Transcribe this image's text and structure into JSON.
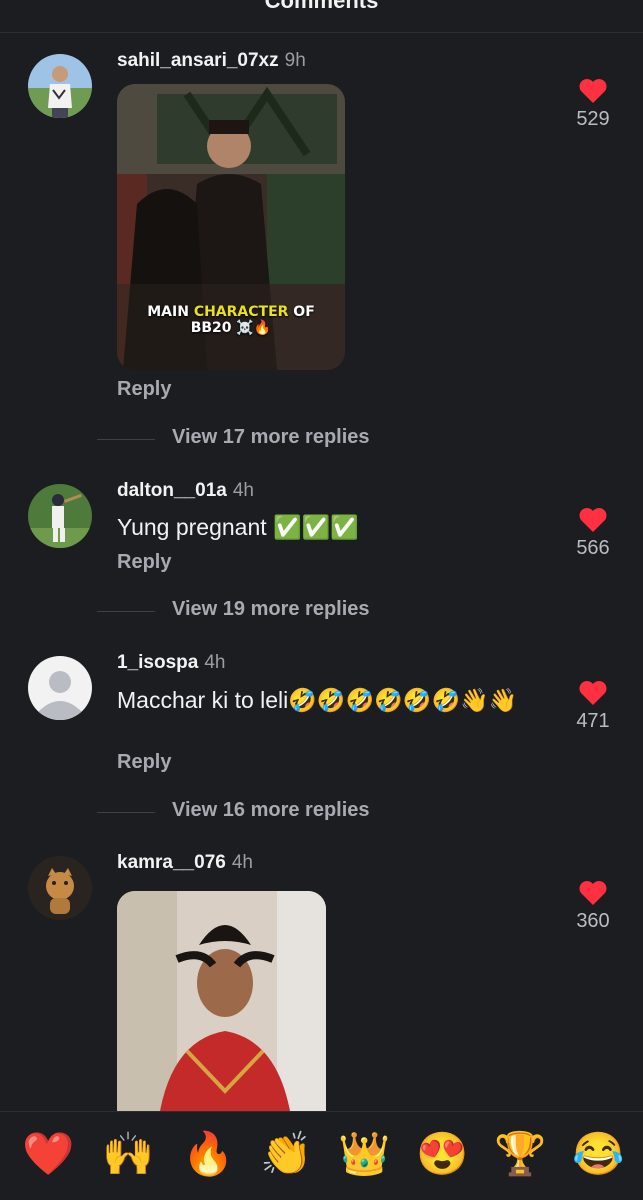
{
  "header": {
    "title": "Comments"
  },
  "comments": [
    {
      "username": "sahil_ansari_07xz",
      "time": "9h",
      "likes": "529",
      "reply_label": "Reply",
      "media_caption_1": "MAIN ",
      "media_caption_highlight": "CHARACTER",
      "media_caption_2": " OF",
      "media_caption_3": "BB20 ☠️🔥",
      "view_more": "View 17 more replies"
    },
    {
      "username": "dalton__01a",
      "time": "4h",
      "text": "Yung pregnant ✅✅✅",
      "likes": "566",
      "reply_label": "Reply",
      "view_more": "View 19 more replies"
    },
    {
      "username": "1_isospa",
      "time": "4h",
      "text": "Macchar ki to leli🤣🤣🤣🤣🤣🤣👋👋",
      "likes": "471",
      "reply_label": "Reply",
      "view_more": "View 16 more replies"
    },
    {
      "username": "kamra__076",
      "time": "4h",
      "likes": "360"
    }
  ],
  "reactions": [
    "❤️",
    "🙌",
    "🔥",
    "👏",
    "👑",
    "😍",
    "🏆",
    "😂"
  ],
  "colors": {
    "like_red": "#ff3040",
    "background": "#1b1d21",
    "highlight_yellow": "#e8e21a"
  }
}
